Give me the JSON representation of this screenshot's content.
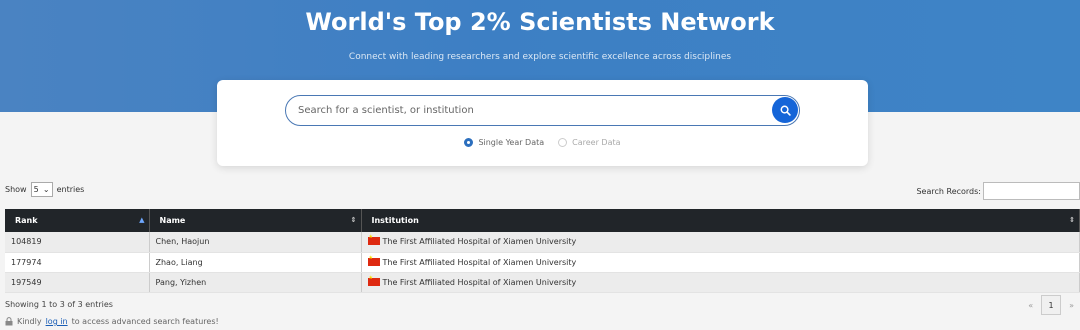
{
  "hero": {
    "title": "World's Top 2% Scientists Network",
    "subtitle": "Connect with leading researchers and explore scientific excellence across disciplines"
  },
  "search": {
    "placeholder": "Search for a scientist, or institution",
    "icon": "search-icon",
    "options": [
      {
        "label": "Single Year Data",
        "selected": true
      },
      {
        "label": "Career Data",
        "selected": false
      }
    ]
  },
  "controls": {
    "show_label": "Show",
    "entries_value": "5",
    "entries_label": "entries",
    "search_records_label": "Search Records:"
  },
  "table": {
    "headers": [
      "Rank",
      "Name",
      "Institution"
    ],
    "rows": [
      {
        "rank": "104819",
        "name": "Chen, Haojun",
        "institution": "The First Affiliated Hospital of Xiamen University"
      },
      {
        "rank": "177974",
        "name": "Zhao, Liang",
        "institution": "The First Affiliated Hospital of Xiamen University"
      },
      {
        "rank": "197549",
        "name": "Pang, Yizhen",
        "institution": "The First Affiliated Hospital of Xiamen University"
      }
    ]
  },
  "footer": {
    "info": "Showing 1 to 3 of 3 entries",
    "prev": "«",
    "page": "1",
    "next": "»",
    "login_prefix": "Kindly",
    "login_link": "log in",
    "login_suffix": "to access advanced search features!"
  },
  "colors": {
    "hero_bg": "#3d7fc4",
    "accent": "#1565d8",
    "table_header": "#212529"
  }
}
